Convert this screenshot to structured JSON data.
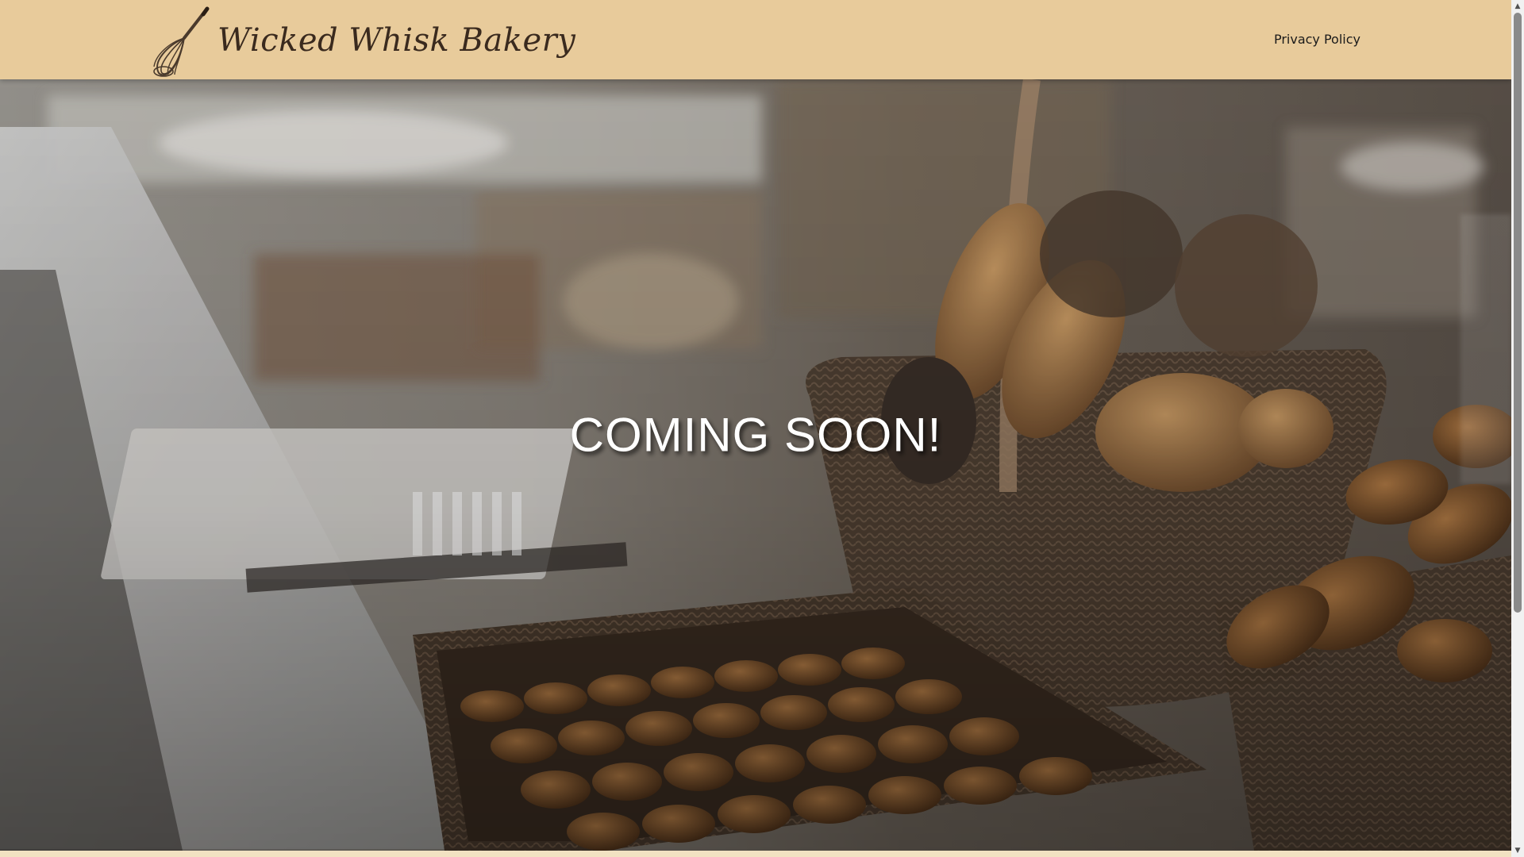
{
  "header": {
    "brand_name": "Wicked Whisk Bakery",
    "logo_icon": "whisk-icon",
    "nav": {
      "privacy_label": "Privacy Policy"
    }
  },
  "hero": {
    "title": "COMING SOON!",
    "background_description_icon": "bakery-photo"
  },
  "colors": {
    "header_bg": "#e8cb9b",
    "page_bg": "#f2e2c2",
    "brand_text": "#3a2a1e",
    "hero_text": "#ffffff"
  },
  "scrollbar": {
    "up_icon": "scroll-up-arrow-icon",
    "down_icon": "scroll-down-arrow-icon"
  }
}
